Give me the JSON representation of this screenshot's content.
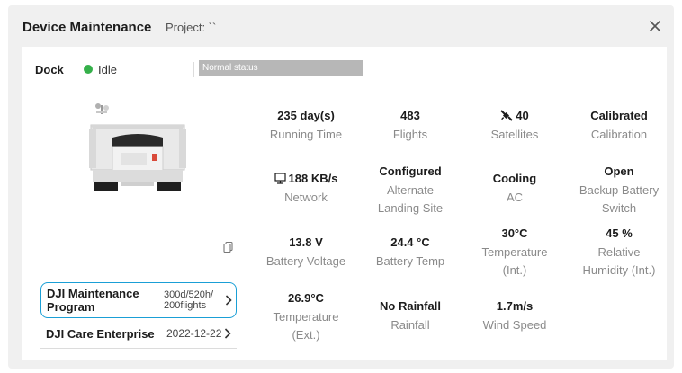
{
  "header": {
    "title": "Device Maintenance",
    "project_label": "Project: ``"
  },
  "dock": {
    "label": "Dock",
    "status": "Idle",
    "status_bar": "Normal status"
  },
  "stats": [
    {
      "value": "235 day(s)",
      "label": "Running Time"
    },
    {
      "value": "483",
      "label": "Flights"
    },
    {
      "value": "40",
      "label": "Satellites",
      "icon": "satellite-icon"
    },
    {
      "value": "Calibrated",
      "label": "Calibration"
    },
    {
      "value": "188 KB/s",
      "label": "Network",
      "icon": "network-icon"
    },
    {
      "value": "Configured",
      "label": "Alternate\nLanding Site"
    },
    {
      "value": "Cooling",
      "label": "AC"
    },
    {
      "value": "Open",
      "label": "Backup Battery\nSwitch"
    },
    {
      "value": "13.8 V",
      "label": "Battery Voltage"
    },
    {
      "value": "24.4 °C",
      "label": "Battery Temp"
    },
    {
      "value": "30°C",
      "label": "Temperature\n(Int.)"
    },
    {
      "value": "45 %",
      "label": "Relative\nHumidity (Int.)"
    },
    {
      "value": "26.9°C",
      "label": "Temperature\n(Ext.)"
    },
    {
      "value": "No Rainfall",
      "label": "Rainfall"
    },
    {
      "value": "1.7m/s",
      "label": "Wind Speed"
    }
  ],
  "sidebar": {
    "items": [
      {
        "name": "DJI Maintenance\nProgram",
        "meta": "300d/520h/\n200flights"
      },
      {
        "name": "DJI Care Enterprise",
        "meta": "2022-12-22"
      }
    ]
  },
  "colors": {
    "accent": "#1a9fd6",
    "status_dot": "#35b04a",
    "status_bar": "#b7b7b7"
  }
}
